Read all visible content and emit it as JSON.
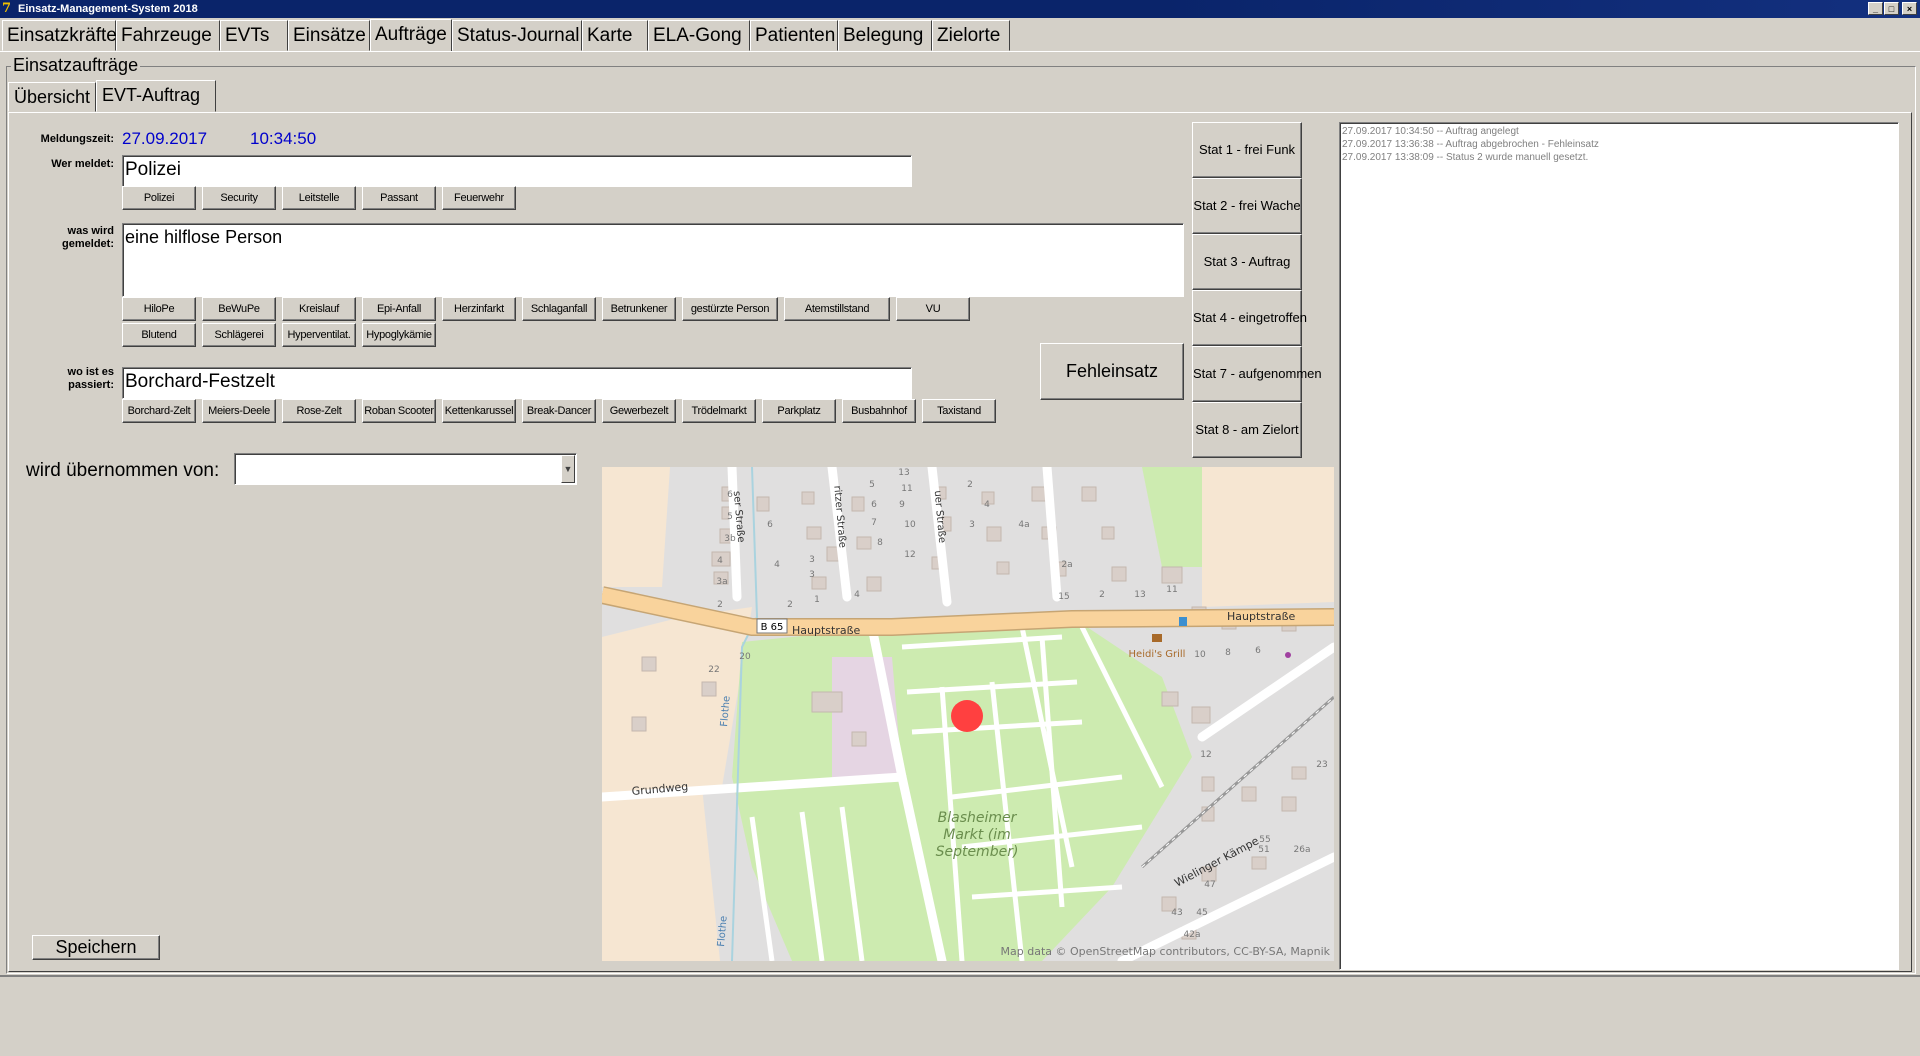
{
  "window": {
    "title": "Einsatz-Management-System 2018",
    "min_symbol": "_",
    "max_symbol": "□",
    "close_symbol": "×"
  },
  "main_tabs": [
    {
      "label": "Einsatzkräfte"
    },
    {
      "label": "Fahrzeuge"
    },
    {
      "label": "EVTs"
    },
    {
      "label": "Einsätze"
    },
    {
      "label": "Aufträge",
      "active": true
    },
    {
      "label": "Status-Journal"
    },
    {
      "label": "Karte"
    },
    {
      "label": "ELA-Gong"
    },
    {
      "label": "Patienten"
    },
    {
      "label": "Belegung"
    },
    {
      "label": "Zielorte"
    }
  ],
  "group_title": "Einsatzaufträge",
  "sub_tabs": [
    {
      "label": "Übersicht"
    },
    {
      "label": "EVT-Auftrag",
      "active": true
    }
  ],
  "form": {
    "meldungszeit_label": "Meldungszeit:",
    "date": "27.09.2017",
    "time": "10:34:50",
    "wer_meldet_label": "Wer meldet:",
    "wer_meldet_value": "Polizei",
    "wer_meldet_quick": [
      "Polizei",
      "Security",
      "Leitstelle",
      "Passant",
      "Feuerwehr"
    ],
    "was_wird_label_1": "was wird",
    "was_wird_label_2": "gemeldet:",
    "was_wird_value": "eine hilflose Person",
    "was_quick_row1": [
      "HiloPe",
      "BeWuPe",
      "Kreislauf",
      "Epi-Anfall",
      "Herzinfarkt",
      "Schlaganfall",
      "Betrunkener",
      "gestürzte Person",
      "Atemstillstand",
      "VU"
    ],
    "was_quick_row2": [
      "Blutend",
      "Schlägerei",
      "Hyperventilat.",
      "Hypoglykämie"
    ],
    "wo_label_1": "wo ist es",
    "wo_label_2": "passiert:",
    "wo_value": "Borchard-Festzelt",
    "wo_quick": [
      "Borchard-Zelt",
      "Meiers-Deele",
      "Rose-Zelt",
      "Roban Scooter",
      "Kettenkarussel",
      "Break-Dancer",
      "Gewerbezelt",
      "Trödelmarkt",
      "Parkplatz",
      "Busbahnhof",
      "Taxistand"
    ],
    "fehleinsatz_label": "Fehleinsatz",
    "uebernommen_label": "wird übernommen von:",
    "uebernommen_value": "",
    "save_label": "Speichern"
  },
  "status_buttons": [
    "Stat 1 - frei Funk",
    "Stat 2 - frei Wache",
    "Stat 3 - Auftrag",
    "Stat 4 - eingetroffen",
    "Stat 7 - aufgenommen",
    "Stat 8 - am Zielort"
  ],
  "log": [
    "27.09.2017 10:34:50 -- Auftrag angelegt",
    "27.09.2017 13:36:38 -- Auftrag abgebrochen - Fehleinsatz",
    "27.09.2017 13:38:09 -- Status 2 wurde manuell gesetzt."
  ],
  "map": {
    "road_main": "Hauptstraße",
    "road_main_2": "Hauptstraße",
    "road_badge": "B 65",
    "road_grundweg": "Grundweg",
    "road_wielinger": "Wielinger Kämpe",
    "road_flothe_1": "Flothe",
    "road_flothe_2": "Flothe",
    "street_1": "ser Straße",
    "street_2": "ritzer Straße",
    "street_3": "uer Straße",
    "poi_heidis": "Heidi's Grill",
    "area_label_1": "Blasheimer",
    "area_label_2": "Markt (im",
    "area_label_3": "September)",
    "attribution": "Map data © OpenStreetMap contributors, CC-BY-SA, Mapnik",
    "house_numbers": [
      "6",
      "5",
      "3b",
      "4",
      "3a",
      "2",
      "6",
      "4",
      "3",
      "2",
      "1",
      "4",
      "3",
      "5",
      "6",
      "7",
      "8",
      "9",
      "10",
      "11",
      "12",
      "13",
      "2",
      "3",
      "4",
      "4a",
      "2a",
      "15",
      "2",
      "13",
      "11",
      "20",
      "22",
      "10",
      "8",
      "6",
      "12",
      "23",
      "51",
      "55",
      "26a",
      "47",
      "45",
      "43",
      "42a"
    ],
    "marker_color": "#ff4040",
    "park_color": "#cdebb0",
    "road_color": "#f9d39c"
  }
}
